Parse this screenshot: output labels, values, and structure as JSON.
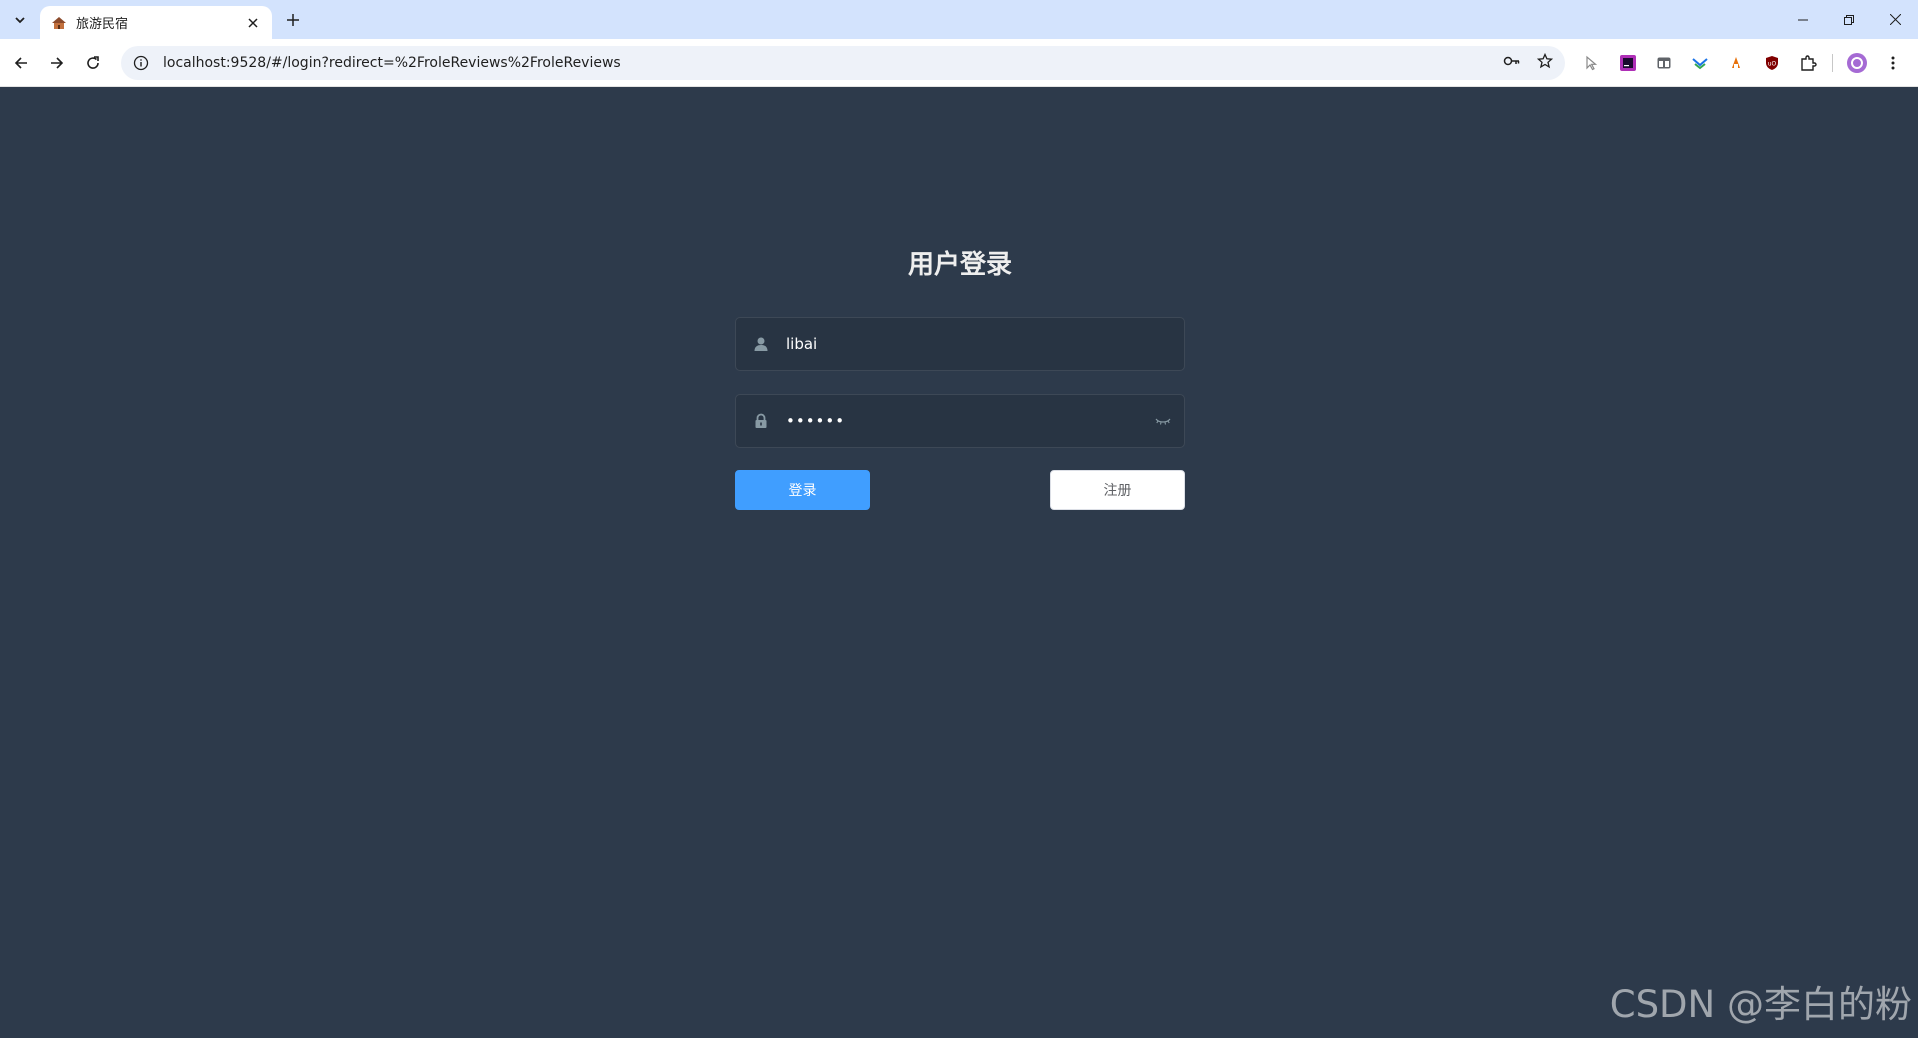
{
  "browser": {
    "tab": {
      "title": "旅游民宿",
      "favicon": "house-icon"
    },
    "address": {
      "url": "localhost:9528/#/login?redirect=%2FroleReviews%2FroleReviews"
    },
    "extensions": [
      "cursor-extension-icon",
      "jetbrains-extension-icon",
      "sidepanel-icon",
      "feishu-extension-icon",
      "fire-extension-icon",
      "ublock-extension-icon",
      "puzzle-extensions-icon"
    ]
  },
  "login": {
    "title": "用户登录",
    "username": {
      "value": "libai",
      "icon": "user-icon"
    },
    "password": {
      "value": "••••••",
      "icon": "lock-icon",
      "toggle_icon": "eye-closed-icon"
    },
    "login_button": "登录",
    "register_button": "注册"
  },
  "watermark": "CSDN @李白的粉",
  "colors": {
    "page_background": "#2d3a4b",
    "field_background": "#283443",
    "primary": "#409eff",
    "tabstrip": "#d3e3fd"
  }
}
